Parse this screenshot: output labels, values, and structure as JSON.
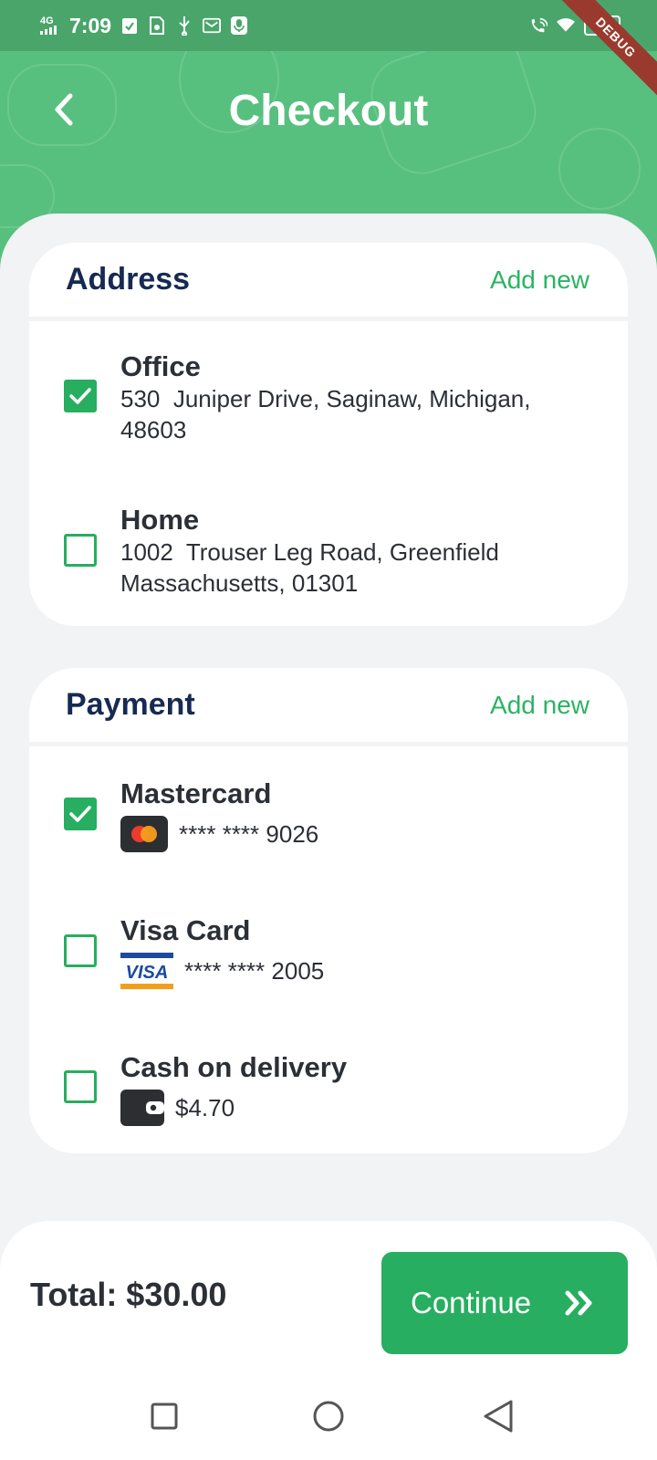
{
  "status_bar": {
    "network": "4G",
    "time": "7:09",
    "battery": "100",
    "debug_banner": "DEBUG"
  },
  "header": {
    "title": "Checkout",
    "back_icon": "chevron-left-icon"
  },
  "address": {
    "title": "Address",
    "add_new": "Add new",
    "items": [
      {
        "label": "Office",
        "address": "530  Juniper Drive, Saginaw, Michigan, 48603",
        "selected": true
      },
      {
        "label": "Home",
        "address": "1002  Trouser Leg Road, Greenfield Massachusetts, 01301",
        "selected": false
      }
    ]
  },
  "payment": {
    "title": "Payment",
    "add_new": "Add new",
    "items": [
      {
        "label": "Mastercard",
        "detail": "**** **** 9026",
        "icon": "mastercard-icon",
        "selected": true
      },
      {
        "label": "Visa Card",
        "detail": "**** **** 2005",
        "icon": "visa-icon",
        "visa_text": "VISA",
        "selected": false
      },
      {
        "label": "Cash on delivery",
        "detail": "$4.70",
        "icon": "wallet-icon",
        "selected": false
      }
    ]
  },
  "footer": {
    "total": "Total: $30.00",
    "continue_label": "Continue",
    "continue_icon": "double-chevron-right-icon"
  },
  "colors": {
    "header_green": "#57c07e",
    "accent_green": "#27ae60",
    "title_navy": "#162a52",
    "text_dark": "#2b2f36"
  }
}
